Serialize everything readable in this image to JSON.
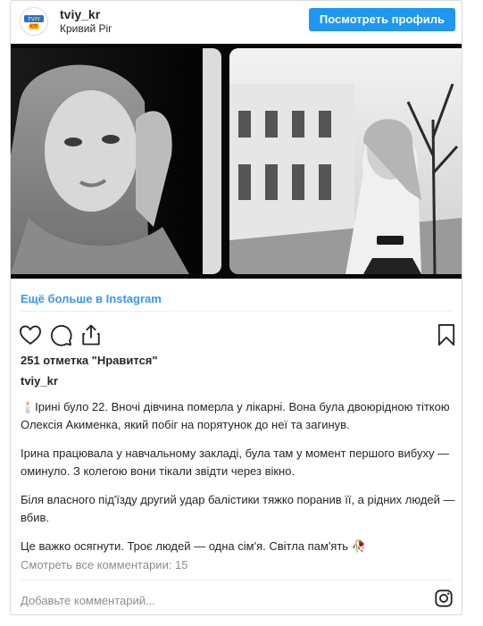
{
  "profile": {
    "username": "tviy_kr",
    "location": "Кривий Ріг",
    "avatar_text": "TVIY KR",
    "view_button": "Посмотреть профиль"
  },
  "media": {
    "left_photo": "portrait-photo",
    "right_photo": "street-photo"
  },
  "more_link": "Ещё больше в Instagram",
  "actions": {
    "like": "heart-icon",
    "comment": "comment-icon",
    "share": "share-icon",
    "save": "bookmark-icon"
  },
  "likes_text": "251 отметка \"Нравится\"",
  "caption": {
    "username": "tviy_kr",
    "paragraphs": [
      "🕯️Ірині було 22. Вночі дівчина померла у лікарні. Вона була двоюрідною тіткою Олексія Акименка, який побіг на порятунок до неї та загинув.",
      "Ірина працювала у навчальному закладі, була там у момент першого вибуху — оминуло. З колегою вони тікали звідти через вікно.",
      "Біля власного під'їзду другий удар балістики тяжко поранив її, а рідних людей — вбив.",
      "Це важко осягнути. Троє людей — одна сім'я. Світла пам'ять 🥀"
    ]
  },
  "comments_link": "Смотреть все комментарии: 15",
  "comment_placeholder": "Добавьте комментарий...",
  "colors": {
    "accent": "#1f96f1",
    "link": "#3897f0",
    "muted": "#8e8e8e",
    "border": "#dbdbdb"
  }
}
